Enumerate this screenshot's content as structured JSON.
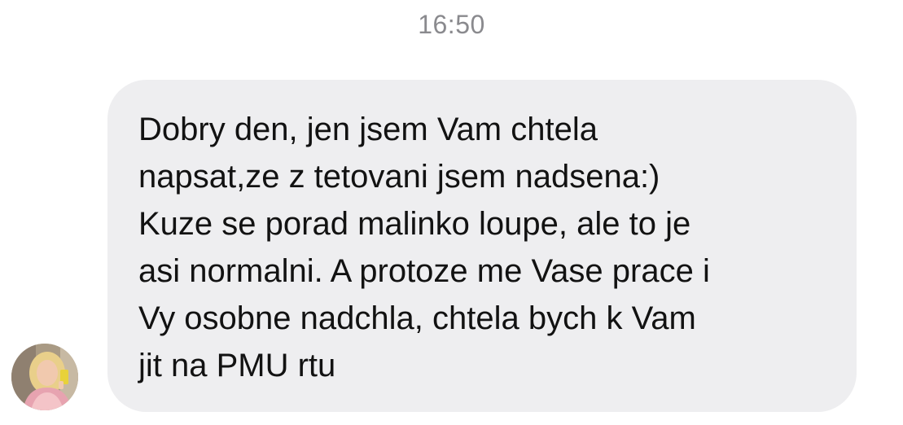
{
  "chat": {
    "timestamp": "16:50",
    "messages": [
      {
        "direction": "incoming",
        "text": "Dobry den, jen jsem Vam chtela\nnapsat,ze z tetovani jsem nadsena:)\nKuze se porad malinko loupe, ale to je\nasi normalni. A protoze me Vase prace i\nVy osobne nadchla, chtela bych k Vam\njit na PMU rtu"
      }
    ],
    "sender": {
      "avatar_icon": "user-photo-avatar"
    }
  },
  "colors": {
    "bubble_background": "#eeeef0",
    "timestamp_text": "#8a8a8e",
    "message_text": "#121212"
  }
}
